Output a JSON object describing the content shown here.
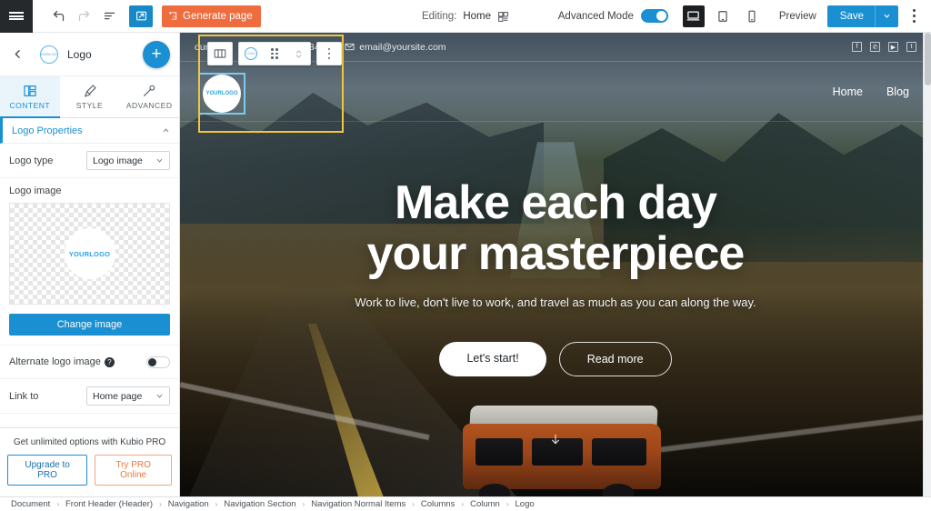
{
  "topbar": {
    "menu_icon": "hamburger-icon",
    "undo_icon": "undo-arrow-icon",
    "redo_icon": "redo-arrow-icon",
    "history_icon": "history-list-icon",
    "theme_icon": "theme-import-icon",
    "generate_label": "Generate page",
    "generate_icon": "ai-sparkle-icon",
    "editing_label": "Editing:",
    "editing_page": "Home",
    "page_settings_icon": "page-settings-icon",
    "advanced_mode_label": "Advanced Mode",
    "advanced_mode_on": true,
    "device_desktop_icon": "desktop-icon",
    "device_tablet_icon": "tablet-icon",
    "device_mobile_icon": "mobile-icon",
    "preview_label": "Preview",
    "save_label": "Save",
    "save_caret_icon": "chevron-down-icon",
    "more_icon": "kebab-menu-icon",
    "accent_blue": "#1a8fd1",
    "accent_orange": "#ef6c3e"
  },
  "sidebar": {
    "back_icon": "chevron-left-icon",
    "title": "Logo",
    "title_icon": "logo-thumb-icon",
    "add_icon": "plus-icon",
    "tabs": [
      {
        "label": "CONTENT",
        "icon": "layout-blocks-icon",
        "active": true
      },
      {
        "label": "STYLE",
        "icon": "paintbrush-icon",
        "active": false
      },
      {
        "label": "ADVANCED",
        "icon": "wrench-icon",
        "active": false
      }
    ],
    "section": {
      "title": "Logo Properties",
      "collapse_icon": "chevron-up-icon"
    },
    "logo_type": {
      "label": "Logo type",
      "value": "Logo image",
      "caret_icon": "chevron-down-icon"
    },
    "logo_image": {
      "label": "Logo image",
      "preview_text": "YOURLOGO",
      "change_button": "Change image"
    },
    "alternate_logo": {
      "label": "Alternate logo image",
      "help_icon": "question-mark-icon",
      "enabled": false
    },
    "link_to": {
      "label": "Link to",
      "value": "Home page",
      "caret_icon": "chevron-down-icon"
    },
    "promo": {
      "text": "Get unlimited options with Kubio PRO",
      "upgrade_label": "Upgrade to PRO",
      "try_label": "Try PRO Online"
    }
  },
  "canvas": {
    "float_toolbar": {
      "columns_icon": "columns-layout-icon",
      "logo_icon": "logo-element-icon",
      "drag_icon": "drag-handle-icon",
      "move_icon": "move-updown-icon",
      "more_icon": "kebab-menu-icon"
    },
    "site_topbar": {
      "address_text": "ountry",
      "phone_icon": "phone-icon",
      "phone": "(000) 123 12345",
      "email_icon": "envelope-icon",
      "email": "email@yoursite.com",
      "social": [
        {
          "name": "facebook-icon",
          "glyph": "f"
        },
        {
          "name": "whatsapp-icon",
          "glyph": "✆"
        },
        {
          "name": "youtube-icon",
          "glyph": "▶"
        },
        {
          "name": "twitter-icon",
          "glyph": "t"
        }
      ]
    },
    "site_logo_text": "YOURLOGO",
    "nav_links": [
      "Home",
      "Blog"
    ],
    "hero": {
      "heading_line1": "Make each day",
      "heading_line2": "your masterpiece",
      "subheading": "Work to live, don't live to work, and travel as much as you can along the way.",
      "primary_button": "Let's start!",
      "secondary_button": "Read more",
      "scroll_icon": "arrow-down-icon"
    },
    "scrollbar_icon": "vertical-scrollbar"
  },
  "breadcrumb": {
    "items": [
      "Document",
      "Front Header (Header)",
      "Navigation",
      "Navigation Section",
      "Navigation Normal Items",
      "Columns",
      "Column",
      "Logo"
    ],
    "separator": "›"
  }
}
